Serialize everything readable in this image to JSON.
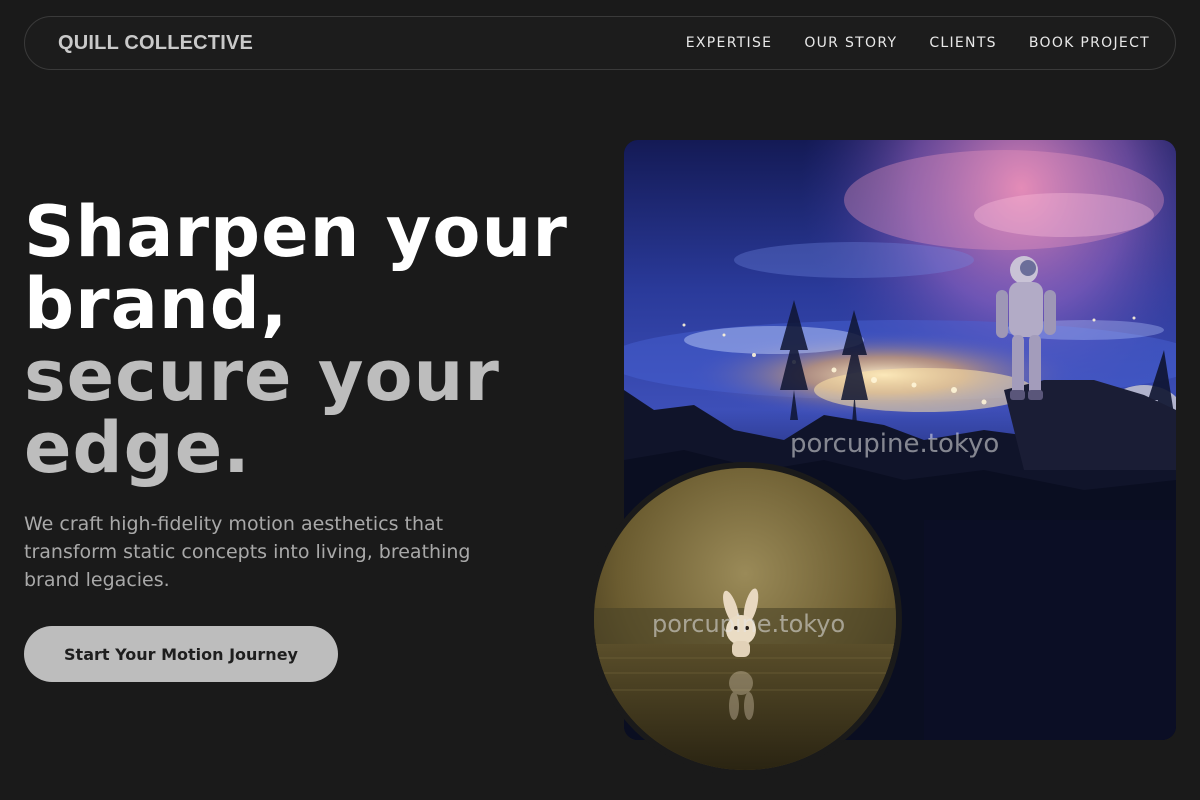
{
  "nav": {
    "brand": "QUILL COLLECTIVE",
    "links": [
      "EXPERTISE",
      "OUR STORY",
      "CLIENTS",
      "BOOK PROJECT"
    ]
  },
  "hero": {
    "title_lines": [
      "Sharpen your",
      "brand,",
      "secure your",
      "edge."
    ],
    "subtitle": "We craft high-fidelity motion aesthetics that transform static concepts into living, breathing brand legacies.",
    "cta_label": "Start Your Motion Journey"
  },
  "media": {
    "main_watermark": "porcupine.tokyo",
    "circle_watermark": "porcupine.tokyo"
  },
  "colors": {
    "background": "#1a1a1a",
    "title_primary": "#ffffff",
    "title_muted": "#bdbdbd",
    "cta_bg": "#bdbdbd"
  }
}
